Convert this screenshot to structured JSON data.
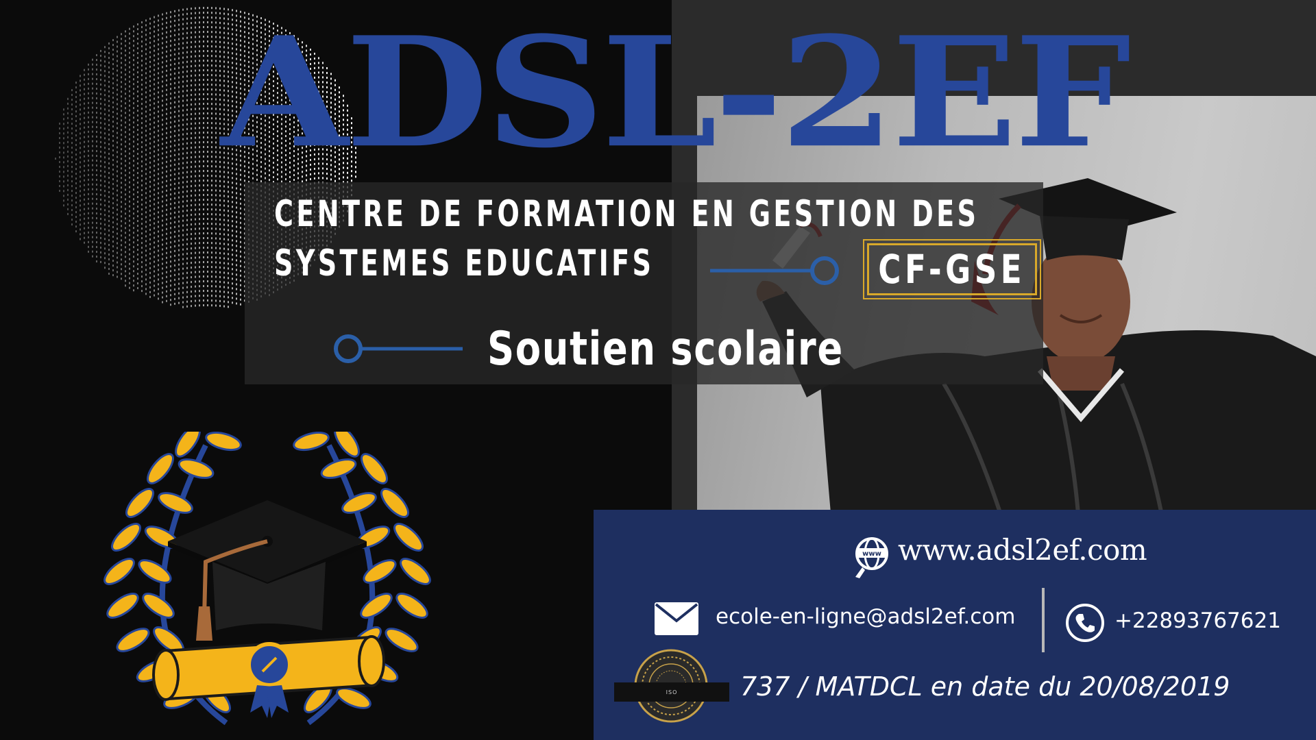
{
  "brand": {
    "title": "ADSL-2EF",
    "subtitle_line1": "CENTRE DE FORMATION EN GESTION DES",
    "subtitle_line2": "SYSTEMES EDUCATIFS",
    "acronym": "CF-GSE",
    "service": "Soutien scolaire"
  },
  "contact": {
    "website": "www.adsl2ef.com",
    "email": "ecole-en-ligne@adsl2ef.com",
    "phone": "+22893767621",
    "registration": "737 / MATDCL en date du 20/08/2019",
    "seal_text": "ISO"
  },
  "icons": {
    "globe": "globe-cursor-icon",
    "mail": "envelope-icon",
    "phone": "phone-icon",
    "seal": "certification-seal-icon",
    "emblem": "graduation-cap-laurel-emblem"
  },
  "colors": {
    "brand_blue": "#27479a",
    "card_navy": "#1e2f60",
    "gold": "#d9a92a",
    "connector_blue": "#2b5fa8"
  }
}
